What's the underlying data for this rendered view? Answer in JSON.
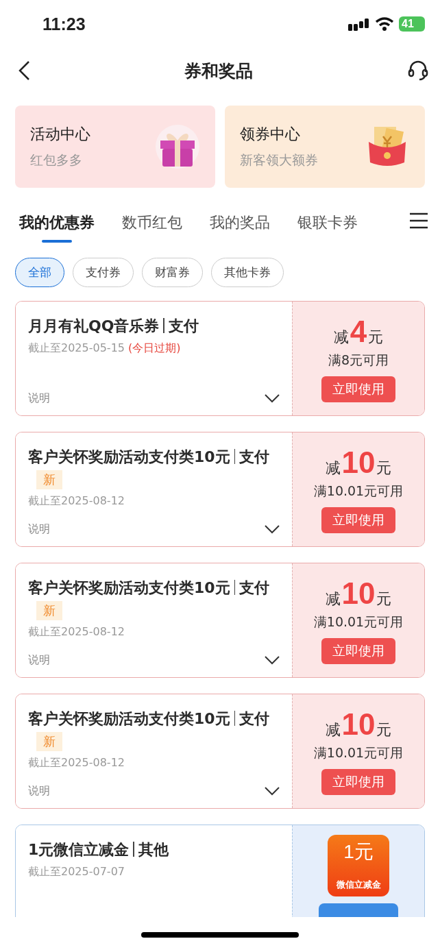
{
  "status_bar": {
    "time": "11:23",
    "battery": "41"
  },
  "nav": {
    "title": "券和奖品"
  },
  "promos": [
    {
      "kind": "gift",
      "title": "活动中心",
      "subtitle": "红包多多"
    },
    {
      "kind": "envelope",
      "title": "领券中心",
      "subtitle": "新客领大额券"
    }
  ],
  "tabs": [
    {
      "label": "我的优惠券",
      "selected": true
    },
    {
      "label": "数币红包",
      "selected": false
    },
    {
      "label": "我的奖品",
      "selected": false
    },
    {
      "label": "银联卡券",
      "selected": false
    }
  ],
  "filters": [
    {
      "label": "全部",
      "selected": true
    },
    {
      "label": "支付券",
      "selected": false
    },
    {
      "label": "财富券",
      "selected": false
    },
    {
      "label": "其他卡券",
      "selected": false
    }
  ],
  "coupons": [
    {
      "kind": "discount",
      "title": "月月有礼QQ音乐券",
      "category": "支付",
      "expiry": "截止至2025-05-15",
      "expiry_note": "(今日过期)",
      "info": "说明",
      "prefix": "减",
      "amount": "4",
      "unit": "元",
      "condition": "满8元可用",
      "button": "立即使用"
    },
    {
      "kind": "discount",
      "title": "客户关怀奖励活动支付类10元",
      "category": "支付",
      "new_label": "新",
      "expiry": "截止至2025-08-12",
      "info": "说明",
      "prefix": "减",
      "amount": "10",
      "unit": "元",
      "condition": "满10.01元可用",
      "button": "立即使用"
    },
    {
      "kind": "discount",
      "title": "客户关怀奖励活动支付类10元",
      "category": "支付",
      "new_label": "新",
      "expiry": "截止至2025-08-12",
      "info": "说明",
      "prefix": "减",
      "amount": "10",
      "unit": "元",
      "condition": "满10.01元可用",
      "button": "立即使用"
    },
    {
      "kind": "discount",
      "title": "客户关怀奖励活动支付类10元",
      "category": "支付",
      "new_label": "新",
      "expiry": "截止至2025-08-12",
      "info": "说明",
      "prefix": "减",
      "amount": "10",
      "unit": "元",
      "condition": "满10.01元可用",
      "button": "立即使用"
    },
    {
      "kind": "voucher",
      "title": "1元微信立减金",
      "category": "其他",
      "expiry": "截止至2025-07-07",
      "badge_value": "1元",
      "badge_label": "微信立减金"
    }
  ]
}
